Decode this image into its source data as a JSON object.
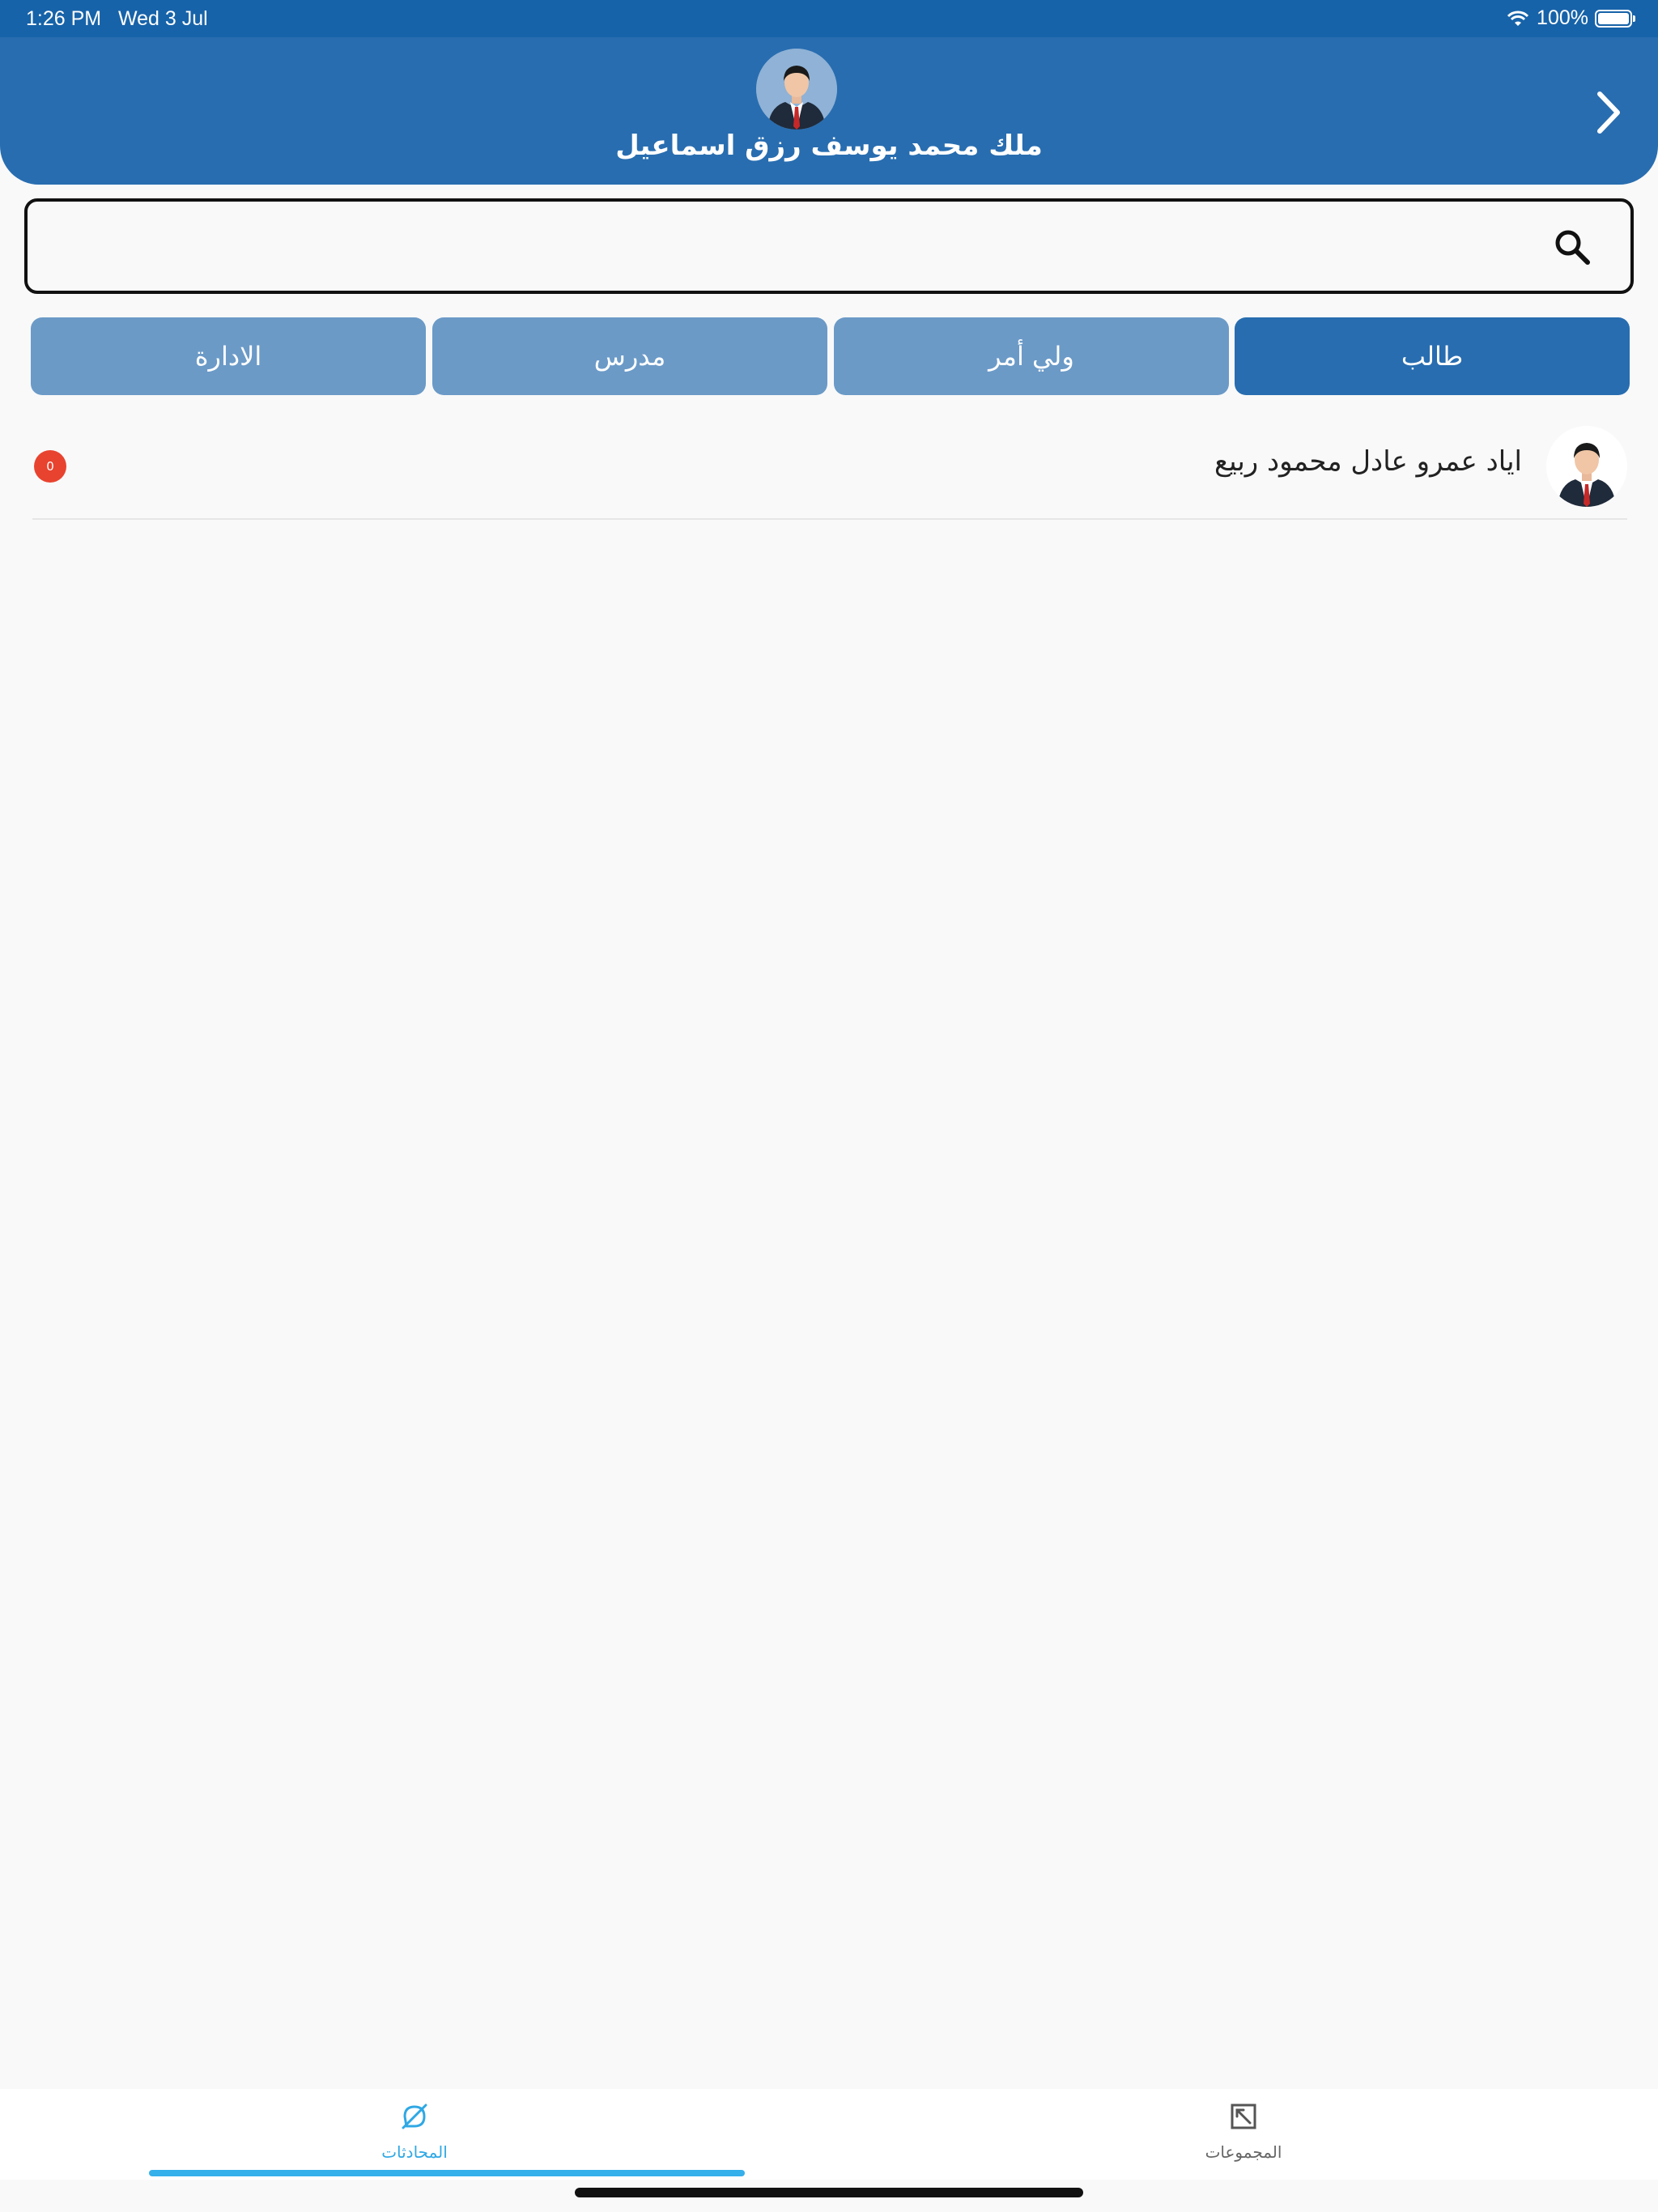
{
  "status_bar": {
    "time": "1:26 PM",
    "date": "Wed 3 Jul",
    "battery": "100%",
    "icons": [
      "wifi-icon",
      "battery-icon"
    ]
  },
  "header": {
    "user_name": "ملك محمد يوسف رزق اسماعيل",
    "avatar_icon": "user-avatar-icon",
    "nav_icon": "chevron-right-icon",
    "background": "#286db0"
  },
  "search": {
    "value": "",
    "placeholder": "",
    "icon": "search-icon"
  },
  "tabs": [
    {
      "label": "طالب",
      "active": true
    },
    {
      "label": "ولي أمر",
      "active": false
    },
    {
      "label": "مدرس",
      "active": false
    },
    {
      "label": "الادارة",
      "active": false
    }
  ],
  "chats": [
    {
      "name": "اياد عمرو عادل محمود ربيع",
      "unread": "0",
      "avatar_icon": "user-avatar-icon"
    }
  ],
  "bottom_nav": {
    "items": [
      {
        "label": "المحادثات",
        "icon": "chat-off-icon",
        "active": true
      },
      {
        "label": "المجموعات",
        "icon": "groups-icon",
        "active": false
      }
    ],
    "accent": "#35b0ea"
  },
  "colors": {
    "primary": "#286db0",
    "tab_inactive": "#6b9ac7",
    "badge": "#e8432f"
  }
}
